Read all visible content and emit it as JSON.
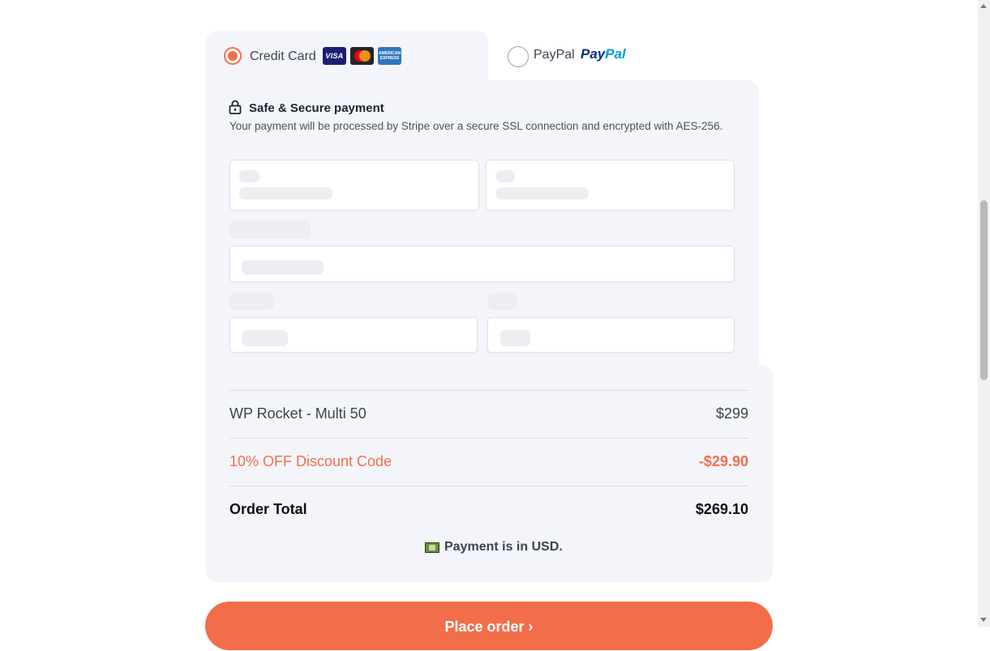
{
  "payment_tabs": {
    "credit_card": {
      "label": "Credit Card",
      "selected": true,
      "card_icons": [
        "visa-icon",
        "mastercard-icon",
        "amex-icon"
      ],
      "visa_text": "VISA",
      "amex_text": "AMERICAN EXPRESS"
    },
    "paypal": {
      "label": "PayPal",
      "selected": false,
      "logo_p1": "Pay",
      "logo_p2": "Pal"
    }
  },
  "secure": {
    "title": "Safe & Secure payment",
    "description": "Your payment will be processed by Stripe over a secure SSL connection and encrypted with AES-256."
  },
  "summary": {
    "item": {
      "name": "WP Rocket - Multi 50",
      "price": "$299"
    },
    "discount": {
      "name": "10% OFF Discount Code",
      "amount": "-$29.90"
    },
    "total": {
      "name": "Order Total",
      "amount": "$269.10"
    },
    "currency_note": "Payment is in USD."
  },
  "order_button": {
    "label": "Place order  ›"
  },
  "colors": {
    "accent": "#f26e4b",
    "panel_bg": "#f4f5fa",
    "text": "#1f2430"
  }
}
